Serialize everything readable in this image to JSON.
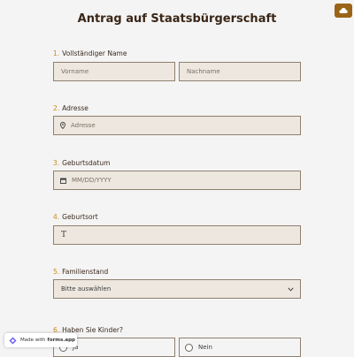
{
  "title": "Antrag auf Staatsbürgerschaft",
  "colors": {
    "accent": "#9a6418",
    "field_bg": "#ede7df",
    "number": "#c98a1c"
  },
  "questions": [
    {
      "num": "1.",
      "label": "Vollständiger Name",
      "first_placeholder": "Vorname",
      "last_placeholder": "Nachname"
    },
    {
      "num": "2.",
      "label": "Adresse",
      "placeholder": "Adresse",
      "icon": "location-pin-icon"
    },
    {
      "num": "3.",
      "label": "Geburtsdatum",
      "placeholder": "MM/DD/YYYY",
      "icon": "calendar-icon"
    },
    {
      "num": "4.",
      "label": "Geburtsort",
      "placeholder": "T"
    },
    {
      "num": "5.",
      "label": "Familienstand",
      "selected": "Bitte auswählen",
      "icon": "chevron-down-icon"
    },
    {
      "num": "6.",
      "label": "Haben Sie Kinder?",
      "options": [
        "Ja",
        "Nein"
      ]
    }
  ],
  "badge": {
    "prefix": "Made with",
    "brand": "forms.app"
  }
}
